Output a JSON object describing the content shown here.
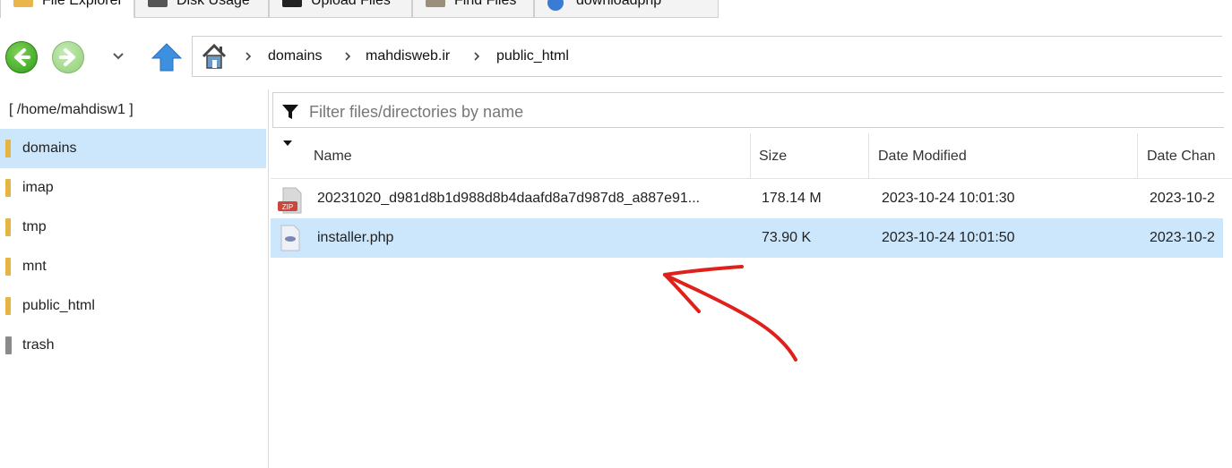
{
  "tabs": [
    {
      "label": "File Explorer",
      "icon": "folder-icon"
    },
    {
      "label": "Disk Usage",
      "icon": "disk-icon"
    },
    {
      "label": "Upload Files",
      "icon": "upload-icon"
    },
    {
      "label": "Find Files",
      "icon": "find-icon"
    },
    {
      "label": "downloadphp",
      "icon": "globe-icon"
    }
  ],
  "breadcrumb": [
    "domains",
    "mahdisweb.ir",
    "public_html"
  ],
  "sidebar": {
    "path": "[ /home/mahdisw1 ]",
    "items": [
      {
        "label": "domains",
        "icon": "folder-icon",
        "selected": true
      },
      {
        "label": "imap",
        "icon": "folder-icon"
      },
      {
        "label": "tmp",
        "icon": "folder-icon"
      },
      {
        "label": "mnt",
        "icon": "folder-icon"
      },
      {
        "label": "public_html",
        "icon": "folder-icon"
      },
      {
        "label": "trash",
        "icon": "trash-icon"
      }
    ]
  },
  "filter": {
    "placeholder": "Filter files/directories by name"
  },
  "columns": {
    "name": "Name",
    "size": "Size",
    "modified": "Date Modified",
    "changed": "Date Chan"
  },
  "files": [
    {
      "name": "20231020_d981d8b1d988d8b4daafd8a7d987d8_a887e91...",
      "size": "178.14 M",
      "modified": "2023-10-24 10:01:30",
      "changed": "2023-10-2",
      "icon": "zip-icon",
      "selected": false
    },
    {
      "name": "installer.php",
      "size": "73.90 K",
      "modified": "2023-10-24 10:01:50",
      "changed": "2023-10-2",
      "icon": "php-file-icon",
      "selected": true
    }
  ],
  "colors": {
    "selection": "#cce6fb",
    "annotation": "#e0201b"
  }
}
